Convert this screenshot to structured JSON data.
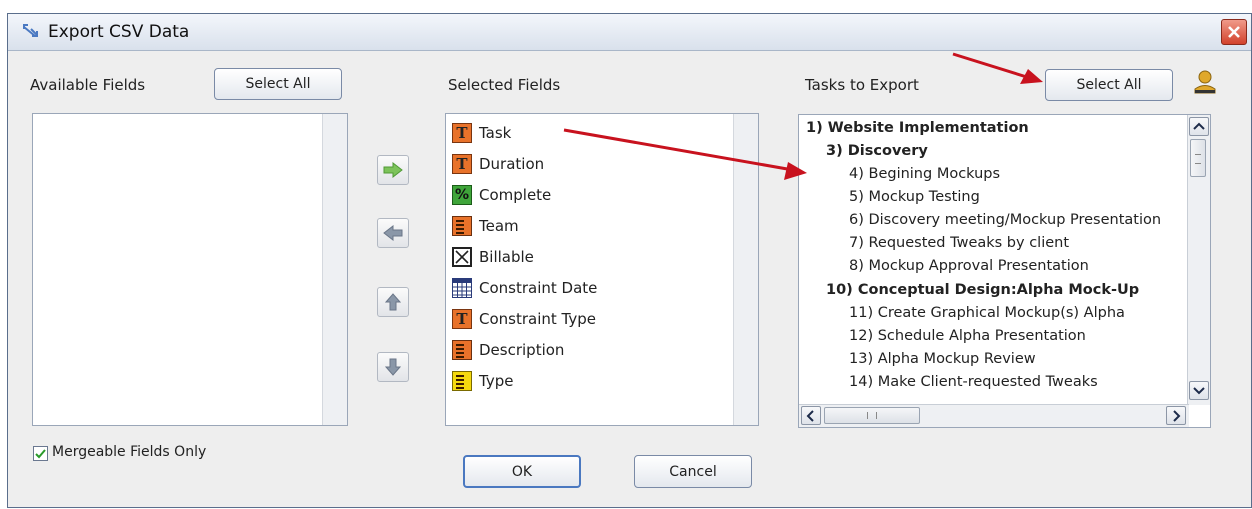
{
  "window": {
    "title": "Export CSV Data"
  },
  "available": {
    "label": "Available Fields",
    "select_all": "Select All"
  },
  "selected": {
    "label": "Selected Fields",
    "fields": [
      {
        "label": "Task",
        "icon": "text-field-icon"
      },
      {
        "label": "Duration",
        "icon": "text-field-icon"
      },
      {
        "label": "Complete",
        "icon": "percent-field-icon"
      },
      {
        "label": "Team",
        "icon": "list-field-icon"
      },
      {
        "label": "Billable",
        "icon": "checkbox-field-icon"
      },
      {
        "label": "Constraint Date",
        "icon": "calendar-field-icon"
      },
      {
        "label": "Constraint Type",
        "icon": "text-field-icon"
      },
      {
        "label": "Description",
        "icon": "list-field-icon"
      },
      {
        "label": "Type",
        "icon": "list-field-yellow-icon"
      }
    ]
  },
  "tasks": {
    "label": "Tasks to Export",
    "select_all": "Select All",
    "items": [
      {
        "label": "1) Website Implementation",
        "bold": true
      },
      {
        "label": "3) Discovery",
        "bold": true
      },
      {
        "label": "4) Begining Mockups",
        "bold": false
      },
      {
        "label": "5) Mockup Testing",
        "bold": false
      },
      {
        "label": "6) Discovery meeting/Mockup Presentation",
        "bold": false
      },
      {
        "label": "7) Requested Tweaks by client",
        "bold": false
      },
      {
        "label": "8) Mockup Approval Presentation",
        "bold": false
      },
      {
        "label": "10) Conceptual Design:Alpha Mock-Up",
        "bold": true
      },
      {
        "label": "11) Create Graphical Mockup(s) Alpha",
        "bold": false
      },
      {
        "label": "12) Schedule Alpha Presentation",
        "bold": false
      },
      {
        "label": "13) Alpha Mockup Review",
        "bold": false
      },
      {
        "label": "14) Make Client-requested Tweaks",
        "bold": false
      }
    ]
  },
  "mergeable": {
    "label": "Mergeable Fields Only",
    "checked": true
  },
  "buttons": {
    "ok": "OK",
    "cancel": "Cancel"
  },
  "colors": {
    "annotation_arrow": "#c8121e",
    "move_right_arrow": "#7cc35a",
    "move_arrow_gray": "#8a97a8"
  }
}
